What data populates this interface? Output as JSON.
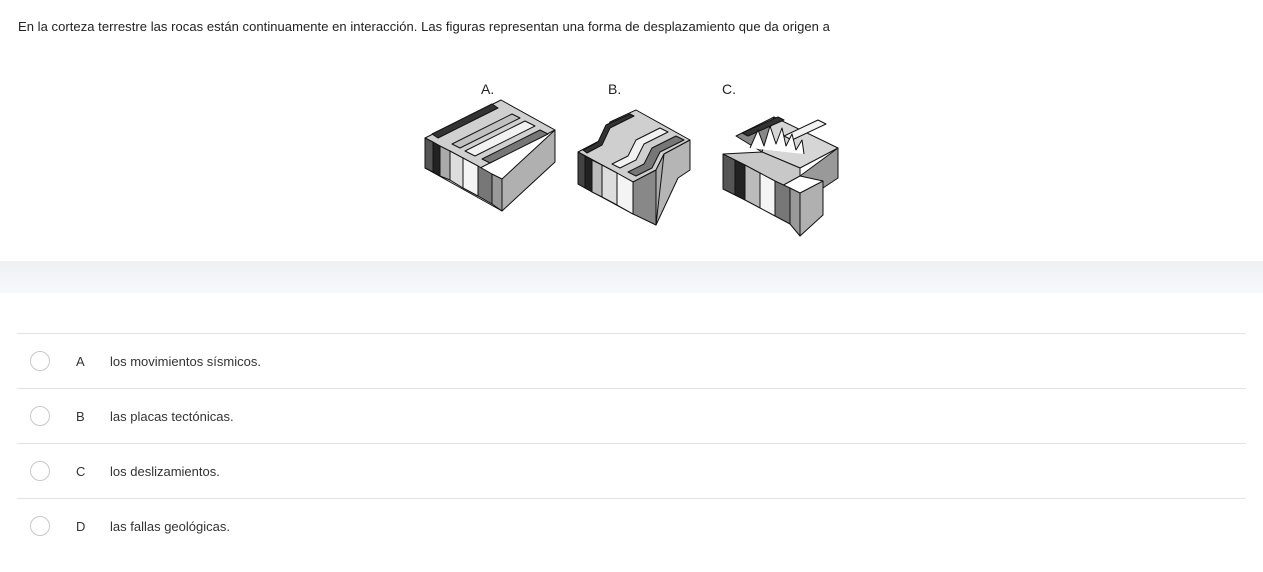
{
  "question": {
    "text": "En la corteza terrestre las rocas están continuamente en interacción. Las figuras representan una forma de desplazamiento que da origen a"
  },
  "figure": {
    "labels": [
      "A.",
      "B.",
      "C."
    ],
    "colors": {
      "dark": "#3a3a3a",
      "mid": "#7a7a7a",
      "light": "#c4c4c4",
      "white": "#f4f4f4",
      "stroke": "#111111"
    }
  },
  "options": [
    {
      "letter": "A",
      "text": "los movimientos sísmicos."
    },
    {
      "letter": "B",
      "text": "las placas tectónicas."
    },
    {
      "letter": "C",
      "text": "los deslizamientos."
    },
    {
      "letter": "D",
      "text": "las fallas geológicas."
    }
  ]
}
